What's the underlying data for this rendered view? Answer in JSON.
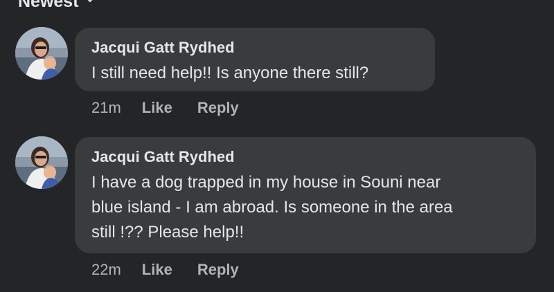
{
  "sort": {
    "label": "Newest"
  },
  "comments": [
    {
      "author": "Jacqui Gatt Rydhed",
      "text": "I still need help!! Is anyone there still?",
      "time": "21m",
      "like_label": "Like",
      "reply_label": "Reply"
    },
    {
      "author": "Jacqui Gatt Rydhed",
      "text_lines": [
        "I have a dog trapped in my house in Souni near",
        "blue island - I am abroad. Is someone in the area",
        "still !?? Please help!!"
      ],
      "time": "22m",
      "like_label": "Like",
      "reply_label": "Reply"
    }
  ],
  "colors": {
    "background": "#242526",
    "bubble": "#3a3b3c",
    "primary_text": "#e4e6eb",
    "secondary_text": "#b0b3b8"
  }
}
